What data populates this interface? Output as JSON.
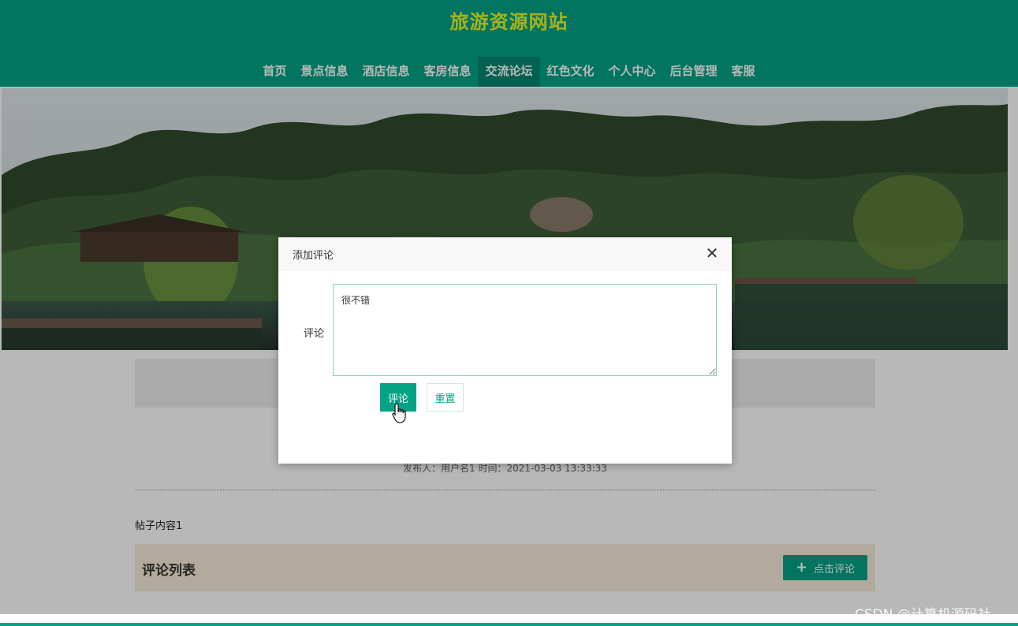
{
  "site": {
    "title": "旅游资源网站"
  },
  "nav": {
    "items": [
      "首页",
      "景点信息",
      "酒店信息",
      "客房信息",
      "交流论坛",
      "红色文化",
      "个人中心",
      "后台管理",
      "客服"
    ],
    "active": "交流论坛"
  },
  "post": {
    "meta": "发布人：用户名1 时间：2021-03-03 13:33:33",
    "content": "帖子内容1"
  },
  "comments": {
    "heading": "评论列表",
    "add_button": "点击评论"
  },
  "dialog": {
    "title": "添加评论",
    "field_label": "评论",
    "field_value": "很不错",
    "submit_label": "评论",
    "reset_label": "重置"
  },
  "watermark": "CSDN @计算机源码社",
  "colors": {
    "primary": "#04a385",
    "title_yellow": "#e8f52a"
  }
}
